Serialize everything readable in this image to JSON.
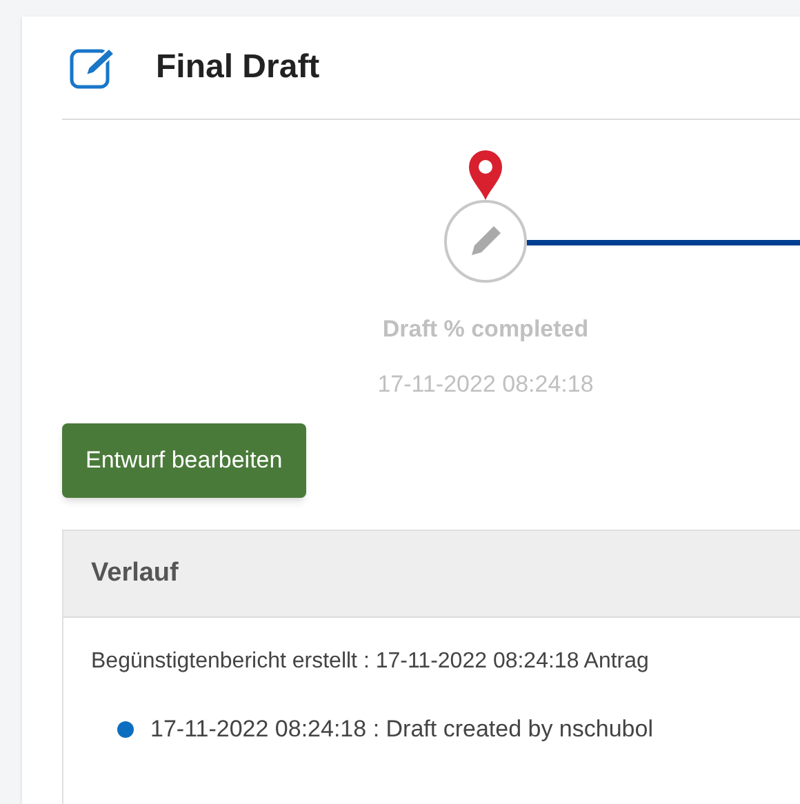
{
  "card": {
    "title": "Final Draft"
  },
  "timeline": {
    "steps": [
      {
        "label": "Draft % completed",
        "date": "17-11-2022 08:24:18",
        "current": true
      }
    ]
  },
  "edit_button": "Entwurf bearbeiten",
  "history": {
    "title": "Verlauf",
    "summary": "Begünstigtenbericht erstellt : 17-11-2022 08:24:18 Antrag",
    "entries": [
      "17-11-2022 08:24:18 : Draft created by nschubol"
    ]
  }
}
